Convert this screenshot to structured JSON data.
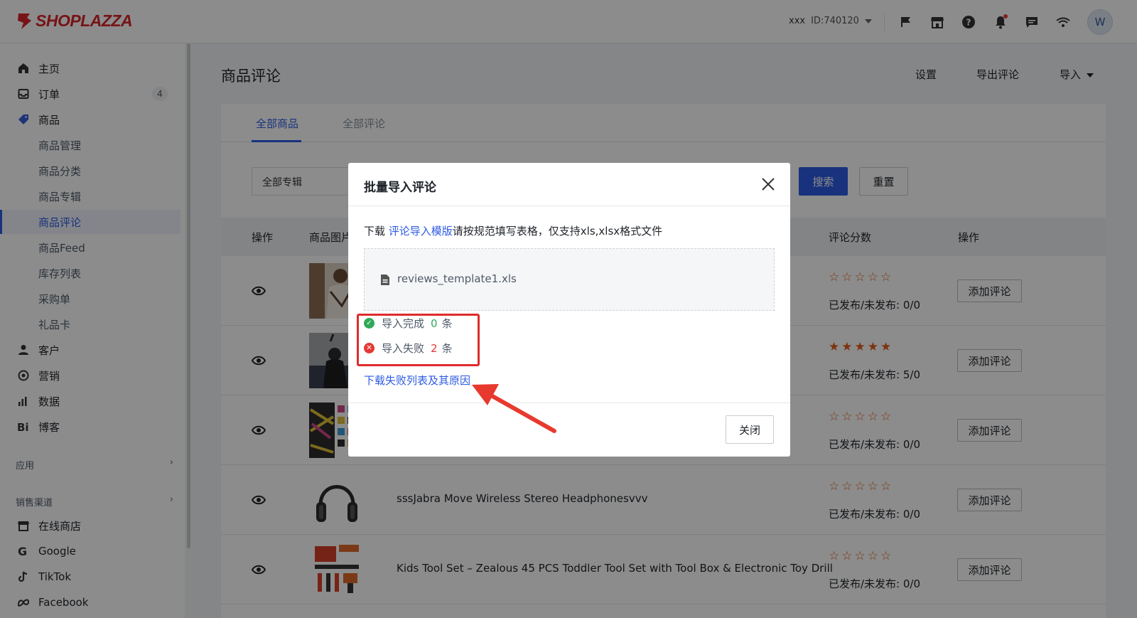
{
  "brand": {
    "name": "SHOPLAZZA",
    "color": "#d8252a"
  },
  "topbar": {
    "store_name": "xxx",
    "store_id": "ID:740120",
    "avatar_letter": "W",
    "icons": [
      "flag-icon",
      "store-icon",
      "help-icon",
      "bell-icon",
      "chat-icon",
      "wifi-icon"
    ]
  },
  "sidebar": {
    "items": [
      {
        "label": "主页",
        "icon": "home-icon"
      },
      {
        "label": "订单",
        "icon": "inbox-icon",
        "badge": "4"
      },
      {
        "label": "商品",
        "icon": "tag-icon"
      },
      {
        "label": "商品管理"
      },
      {
        "label": "商品分类"
      },
      {
        "label": "商品专辑"
      },
      {
        "label": "商品评论",
        "active": true
      },
      {
        "label": "商品Feed"
      },
      {
        "label": "库存列表"
      },
      {
        "label": "采购单"
      },
      {
        "label": "礼品卡"
      },
      {
        "label": "客户",
        "icon": "user-icon"
      },
      {
        "label": "营销",
        "icon": "target-icon"
      },
      {
        "label": "数据",
        "icon": "bar-chart-icon"
      },
      {
        "label": "博客",
        "icon": "blog-icon"
      }
    ],
    "apps_label": "应用",
    "channels_label": "销售渠道",
    "channels": [
      {
        "label": "在线商店",
        "icon": "store-icon"
      },
      {
        "label": "Google",
        "icon": "google-icon"
      },
      {
        "label": "TikTok",
        "icon": "tiktok-icon"
      },
      {
        "label": "Facebook",
        "icon": "meta-icon"
      }
    ]
  },
  "page": {
    "title": "商品评论",
    "actions": {
      "settings": "设置",
      "export": "导出评论",
      "import": "导入"
    }
  },
  "tabs": [
    {
      "label": "全部商品",
      "active": true
    },
    {
      "label": "全部评论"
    }
  ],
  "filters": {
    "album_select": "全部专辑",
    "search_button": "搜索",
    "reset_button": "重置"
  },
  "table": {
    "headers": {
      "op": "操作",
      "image": "商品图片",
      "score": "评论分数",
      "action": "操作"
    },
    "rows": [
      {
        "name": "",
        "rating": 0,
        "published": "已发布/未发布: 0/0",
        "action": "添加评论"
      },
      {
        "name": "",
        "rating": 5,
        "published": "已发布/未发布: 5/0",
        "action": "添加评论"
      },
      {
        "name": "",
        "rating": 0,
        "published": "已发布/未发布: 0/0",
        "action": "添加评论"
      },
      {
        "name": "sssJabra Move Wireless Stereo Headphonesvvv",
        "rating": 0,
        "published": "已发布/未发布: 0/0",
        "action": "添加评论"
      },
      {
        "name": "Kids Tool Set – Zealous 45 PCS Toddler Tool Set with Tool Box & Electronic Toy Drill",
        "rating": 0,
        "published": "已发布/未发布: 0/0",
        "action": "添加评论"
      }
    ]
  },
  "modal": {
    "title": "批量导入评论",
    "desc_prefix": "下载 ",
    "template_link": "评论导入模版",
    "desc_suffix": "请按规范填写表格，仅支持xls,xlsx格式文件",
    "file_name": "reviews_template1.xls",
    "success_label": "导入完成",
    "success_count": "0",
    "fail_label": "导入失败",
    "fail_count": "2",
    "unit": "条",
    "fail_link": "下载失败列表及其原因",
    "close_button": "关闭"
  },
  "colors": {
    "primary": "#2d5be3",
    "star": "#e05f1b",
    "success": "#2faa59",
    "error": "#e53935",
    "highlight": "#e02b2b"
  }
}
